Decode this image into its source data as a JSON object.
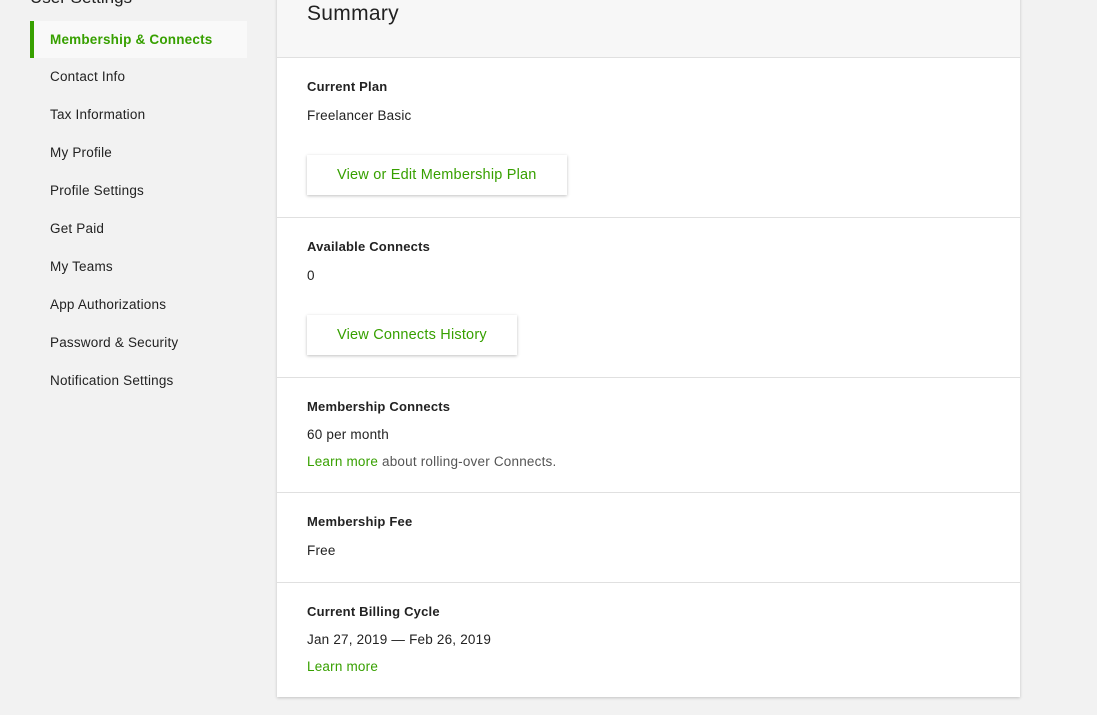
{
  "sidebar": {
    "heading": "User Settings",
    "items": [
      {
        "label": "Membership & Connects"
      },
      {
        "label": "Contact Info"
      },
      {
        "label": "Tax Information"
      },
      {
        "label": "My Profile"
      },
      {
        "label": "Profile Settings"
      },
      {
        "label": "Get Paid"
      },
      {
        "label": "My Teams"
      },
      {
        "label": "App Authorizations"
      },
      {
        "label": "Password & Security"
      },
      {
        "label": "Notification Settings"
      }
    ],
    "active_index": 0
  },
  "summary": {
    "title": "Summary",
    "current_plan": {
      "label": "Current Plan",
      "value": "Freelancer Basic",
      "button": "View or Edit Membership Plan"
    },
    "available_connects": {
      "label": "Available Connects",
      "value": "0",
      "button": "View Connects History"
    },
    "membership_connects": {
      "label": "Membership Connects",
      "value": "60 per month",
      "learn_more": "Learn more",
      "learn_more_suffix": " about rolling-over Connects."
    },
    "membership_fee": {
      "label": "Membership Fee",
      "value": "Free"
    },
    "billing_cycle": {
      "label": "Current Billing Cycle",
      "value": "Jan 27, 2019 — Feb 26, 2019",
      "learn_more": "Learn more"
    }
  },
  "colors": {
    "accent": "#37a000",
    "background": "#f2f2f2",
    "card": "#ffffff"
  }
}
